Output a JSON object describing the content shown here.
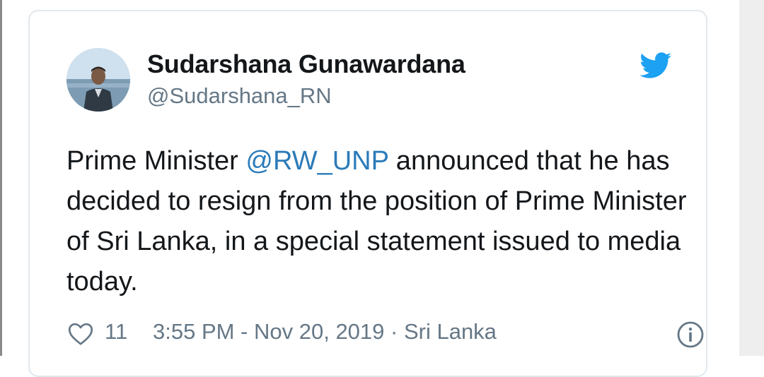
{
  "tweet": {
    "display_name": "Sudarshana Gunawardana",
    "handle": "@Sudarshana_RN",
    "text_before": "Prime Minister ",
    "mention": "@RW_UNP",
    "text_after": " announced that he has decided to resign from the position of Prime Minister of Sri Lanka, in a special statement issued to media today.",
    "like_count": "11",
    "timestamp": "3:55 PM - Nov 20, 2019 · Sri Lanka"
  },
  "colors": {
    "brand": "#1da1f2",
    "mention": "#2b7bb9",
    "text": "#14171a",
    "muted": "#657786"
  },
  "icons": {
    "brand": "twitter-bird-icon",
    "like": "heart-icon",
    "info": "info-icon"
  }
}
